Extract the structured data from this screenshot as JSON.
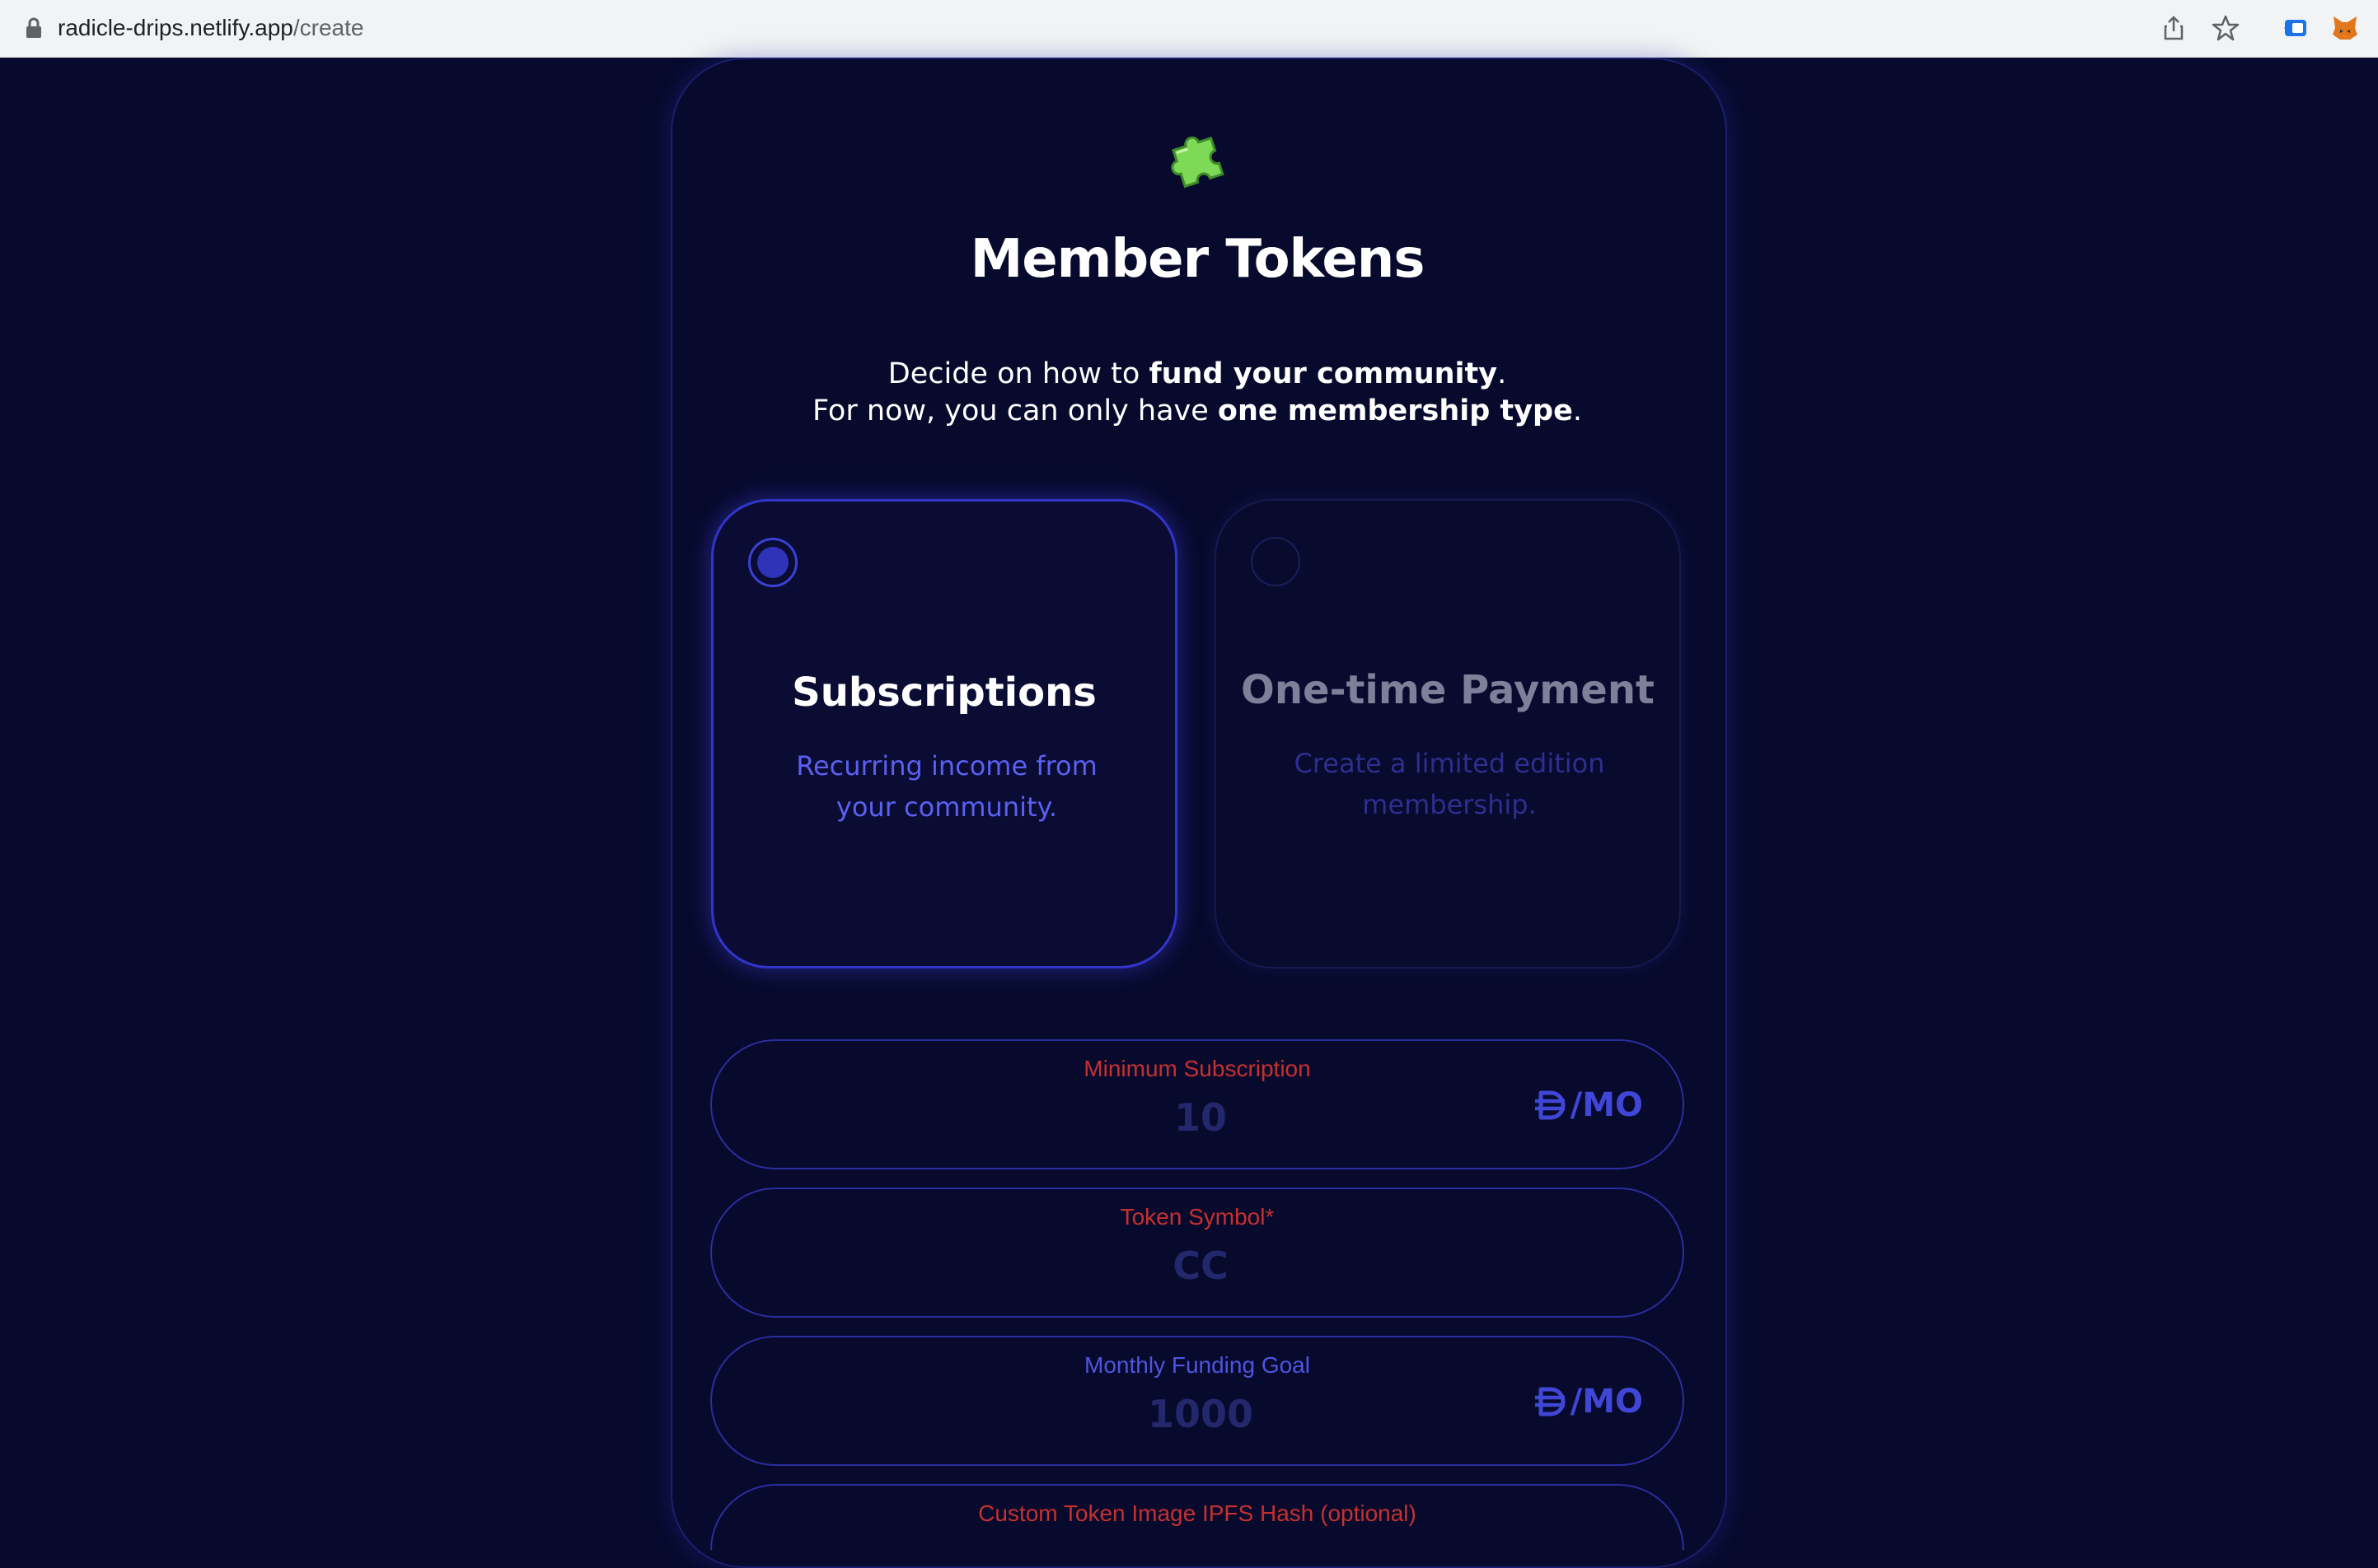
{
  "browser": {
    "url_domain": "radicle-drips.netlify.app",
    "url_path": "/create"
  },
  "page": {
    "title": "Member Tokens",
    "subtitle_line1_prefix": "Decide on how to ",
    "subtitle_line1_bold": "fund your community",
    "subtitle_line1_suffix": ".",
    "subtitle_line2_prefix": "For now, you can only have ",
    "subtitle_line2_bold": "one membership type",
    "subtitle_line2_suffix": "."
  },
  "options": [
    {
      "title": "Subscriptions",
      "description": "Recurring income from your community.",
      "selected": true
    },
    {
      "title": "One-time Payment",
      "description": "Create a limited edition membership.",
      "selected": false
    }
  ],
  "fields": {
    "min_subscription": {
      "label": "Minimum Subscription",
      "placeholder": "10",
      "unit": "/MO"
    },
    "token_symbol": {
      "label": "Token Symbol*",
      "placeholder": "CC"
    },
    "monthly_goal": {
      "label": "Monthly Funding Goal",
      "placeholder": "1000",
      "unit": "/MO"
    },
    "ipfs_hash": {
      "label": "Custom Token Image IPFS Hash (optional)"
    }
  },
  "icons": {
    "puzzle": "puzzle-icon",
    "currency": "dai-icon"
  },
  "colors": {
    "background": "#070a2c",
    "accent": "#3235c9",
    "label_red": "#c63030",
    "label_blue": "#4d55e0"
  }
}
